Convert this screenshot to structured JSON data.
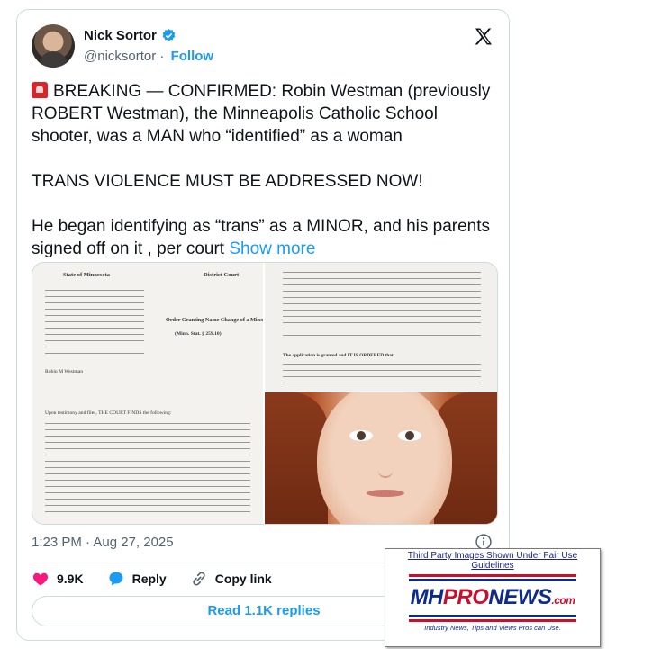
{
  "author": {
    "display_name": "Nick Sortor",
    "handle": "@nicksortor",
    "separator": "·",
    "follow_label": "Follow"
  },
  "tweet": {
    "text": "BREAKING — CONFIRMED: Robin Westman (previously ROBERT Westman), the Minneapolis Catholic School shooter, was a MAN who “identified” as a woman\n\nTRANS VIOLENCE MUST BE ADDRESSED NOW!\n\nHe began identifying as “trans” as a MINOR, and his parents signed off on it , per court ",
    "show_more": "Show more",
    "timestamp": "1:23 PM · Aug 27, 2025"
  },
  "document": {
    "state": "State of Minnesota",
    "court": "District Court",
    "title": "Order Granting Name Change of a Minor",
    "statute": "(Minn. Stat. § 259.10)",
    "minor_name": "Robin M Westman",
    "findings_heading": "Upon testimony and files, THE COURT FINDS the following:",
    "granted": "The application is granted and IT IS ORDERED that:"
  },
  "actions": {
    "likes": "9.9K",
    "reply_label": "Reply",
    "copy_label": "Copy link",
    "read_replies": "Read 1.1K replies"
  },
  "watermark": {
    "caption": "Third Party Images Shown Under Fair Use Guidelines",
    "logo_mh": "MH",
    "logo_pro": "PRO",
    "logo_news": "NEWS",
    "logo_com": ".com",
    "tagline": "Industry News, Tips and Views Pros can Use."
  },
  "colors": {
    "accent": "#1d9bf0",
    "like": "#f91880",
    "text_secondary": "#536471"
  }
}
